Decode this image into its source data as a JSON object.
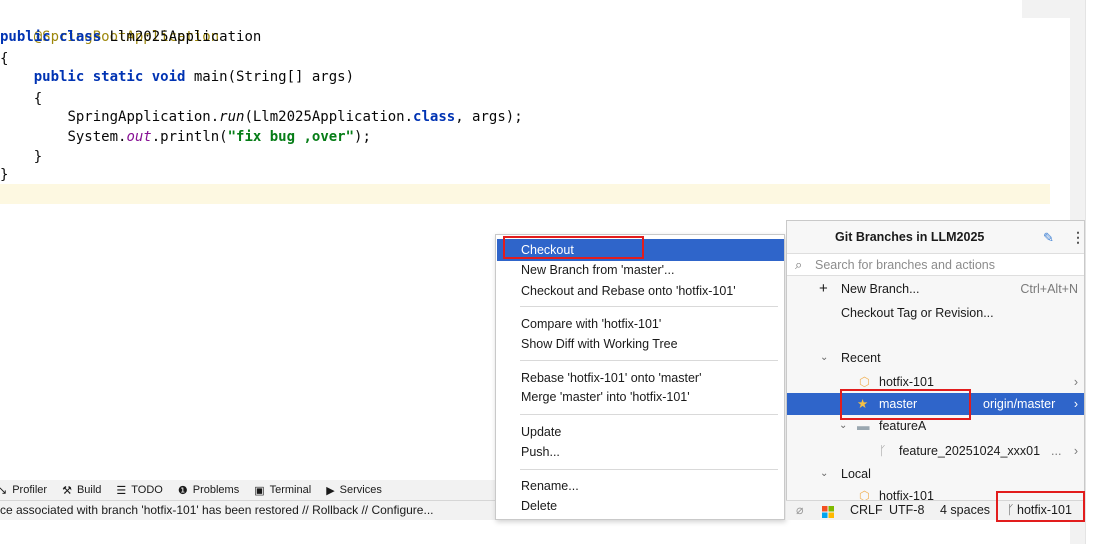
{
  "editor": {
    "lines": {
      "l1": "@SpringBootApplication",
      "l2_kw": "public class",
      "l2_name": "Llm2025Application",
      "l3": "{",
      "l4_kw": "public static void",
      "l4_rest": "main(String[] args)",
      "l5": "{",
      "l6_a": "SpringApplication.",
      "l6_b": "run",
      "l6_c": "(Llm2025Application.",
      "l6_d": "class",
      "l6_e": ", args);",
      "l7_a": "System.",
      "l7_b": "out",
      "l7_c": ".println(",
      "l7_d": "\"fix bug ,over\"",
      "l7_e": ");",
      "l8": "}",
      "l9": "}"
    }
  },
  "toolwindows": {
    "profiler": "Profiler",
    "build": "Build",
    "todo": "TODO",
    "problems": "Problems",
    "terminal": "Terminal",
    "services": "Services"
  },
  "status_message": "ce associated with branch 'hotfix-101' has been restored // Rollback // Configure...",
  "context_menu": {
    "checkout": "Checkout",
    "new_branch": "New Branch from 'master'...",
    "checkout_rebase": "Checkout and Rebase onto 'hotfix-101'",
    "compare": "Compare with 'hotfix-101'",
    "show_diff": "Show Diff with Working Tree",
    "rebase": "Rebase 'hotfix-101' onto 'master'",
    "merge": "Merge 'master' into 'hotfix-101'",
    "update": "Update",
    "push": "Push...",
    "rename": "Rename...",
    "delete": "Delete"
  },
  "git_popup": {
    "title": "Git Branches in LLM2025",
    "search_placeholder": "Search for branches and actions",
    "new_branch": "New Branch...",
    "new_branch_shortcut": "Ctrl+Alt+N",
    "checkout_tag": "Checkout Tag or Revision...",
    "recent_label": "Recent",
    "recent_hotfix": "hotfix-101",
    "recent_master": "master",
    "recent_master_remote": "origin/master",
    "featureA": "featureA",
    "feature_branch": "feature_20251024_xxx01",
    "feature_branch_more": "...",
    "local_label": "Local",
    "local_hotfix": "hotfix-101"
  },
  "ide_status": {
    "line_sep": "CRLF",
    "encoding": "UTF-8",
    "indent": "4 spaces",
    "branch": "hotfix-101"
  },
  "colors": {
    "selection": "#2f65ca",
    "highlight_box": "#e21d1d",
    "caret_line": "#fdf8e1"
  }
}
